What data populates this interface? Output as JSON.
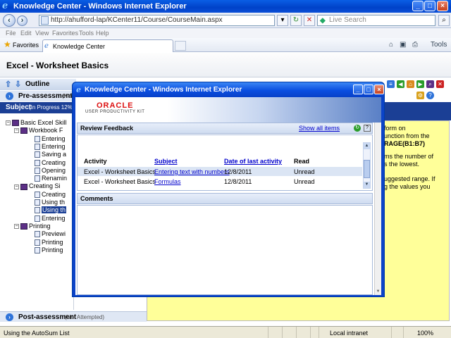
{
  "window": {
    "title": "Knowledge Center - Windows Internet Explorer",
    "address": "http://ahufford-lap/KCenter11/Course/CourseMain.aspx",
    "search_placeholder": "Live Search"
  },
  "menu": [
    "File",
    "Edit",
    "View",
    "Favorites",
    "Tools",
    "Help"
  ],
  "favorites": {
    "label": "Favorites",
    "tab_label": "Knowledge Center",
    "tools_label": "Tools"
  },
  "page": {
    "title": "Excel - Worksheet Basics",
    "outline_label": "Outline",
    "pre_assessment": {
      "label": "Pre-assessment",
      "status": "(Not"
    },
    "subject": {
      "label": "Subject",
      "status": "(In Progress 12%)"
    },
    "post_assessment": {
      "label": "Post-assessment",
      "status": "(Not Attempted)"
    },
    "tree": [
      {
        "label": "Basic Excel Skill",
        "type": "book",
        "level": 0,
        "toggle": "−"
      },
      {
        "label": "Workbook F",
        "type": "book",
        "level": 1,
        "toggle": "−"
      },
      {
        "label": "Entering",
        "type": "doc",
        "level": 2
      },
      {
        "label": "Entering",
        "type": "doc",
        "level": 2
      },
      {
        "label": "Saving a",
        "type": "doc",
        "level": 2
      },
      {
        "label": "Creating",
        "type": "doc",
        "level": 2
      },
      {
        "label": "Opening",
        "type": "doc",
        "level": 2
      },
      {
        "label": "Renamin",
        "type": "doc",
        "level": 2
      },
      {
        "label": "Creating Si",
        "type": "book",
        "level": 1,
        "toggle": "−"
      },
      {
        "label": "Creating",
        "type": "doc",
        "level": 2
      },
      {
        "label": "Using th",
        "type": "doc",
        "level": 2
      },
      {
        "label": "Using th",
        "type": "doc",
        "level": 2,
        "selected": true
      },
      {
        "label": "Entering",
        "type": "doc",
        "level": 2
      },
      {
        "label": "Printing",
        "type": "book",
        "level": 1,
        "toggle": "−"
      },
      {
        "label": "Previewi",
        "type": "doc",
        "level": 2
      },
      {
        "label": "Printing",
        "type": "doc",
        "level": 2
      },
      {
        "label": "Printing",
        "type": "doc",
        "level": 2
      }
    ],
    "content_lines": [
      {
        "text": "form on",
        "bold": false
      },
      {
        "text": "unction from the",
        "bold": false
      },
      {
        "text": "RAGE(B1:B7)",
        "bold": true
      },
      {
        "text": "ms the number of",
        "bold": false
      },
      {
        "text": "s the lowest.",
        "bold": false
      },
      {
        "text": "uggested range. If",
        "bold": false
      },
      {
        "text": "g the values you",
        "bold": false
      }
    ]
  },
  "popup": {
    "title": "Knowledge Center - Windows Internet Explorer",
    "brand": "ORACLE",
    "brand_sub": "USER PRODUCTIVITY KIT",
    "review_title": "Review Feedback",
    "show_all": "Show all items",
    "help_icon": "?",
    "columns": [
      "Activity",
      "Subject",
      "Date of last activity",
      "Read"
    ],
    "rows": [
      {
        "activity": "Excel - Worksheet Basics",
        "subject": "Entering text with numbers",
        "date": "12/8/2011",
        "read": "Unread"
      },
      {
        "activity": "Excel - Worksheet Basics",
        "subject": "Formulas",
        "date": "12/8/2011",
        "read": "Unread"
      }
    ],
    "comments_title": "Comments"
  },
  "status": {
    "text": "Using the AutoSum List",
    "zone": "Local intranet",
    "zoom": "100%"
  }
}
